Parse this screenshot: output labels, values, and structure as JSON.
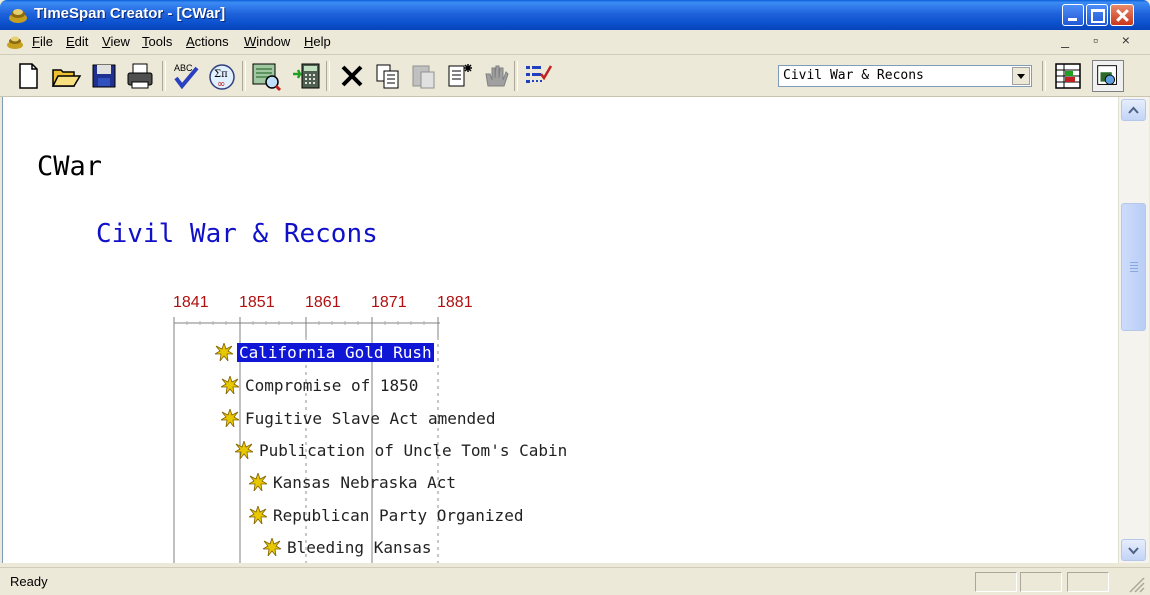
{
  "window": {
    "title": "TImeSpan Creator - [CWar]"
  },
  "menu": [
    {
      "label": "File"
    },
    {
      "label": "Edit"
    },
    {
      "label": "View"
    },
    {
      "label": "Tools"
    },
    {
      "label": "Actions"
    },
    {
      "label": "Window"
    },
    {
      "label": "Help"
    }
  ],
  "toolbar": {
    "timeline_select": "Civil War & Recons",
    "buttons": [
      "new-icon",
      "open-icon",
      "save-icon",
      "print-icon",
      "spellcheck-icon",
      "math-symbols-icon",
      "find-timeline-icon",
      "calculator-icon",
      "delete-icon",
      "copy-icon",
      "paste-icon",
      "paste-special-icon",
      "hand-icon",
      "checklist-icon",
      "properties-icon",
      "zoom-view-icon"
    ]
  },
  "content": {
    "doc_title": "CWar",
    "timeline_title": "Civil War & Recons",
    "years": [
      "1841",
      "1851",
      "1861",
      "1871",
      "1881"
    ],
    "events": [
      {
        "label": "California Gold Rush"
      },
      {
        "label": "Compromise of 1850"
      },
      {
        "label": "Fugitive Slave Act amended"
      },
      {
        "label": "Publication of Uncle Tom's Cabin"
      },
      {
        "label": "Kansas Nebraska Act"
      },
      {
        "label": "Republican Party Organized"
      },
      {
        "label": "Bleeding Kansas"
      }
    ]
  },
  "status": {
    "text": "Ready"
  },
  "colors": {
    "title_bar": "#0a4fcc",
    "timeline_title": "#1010c8",
    "year_labels": "#b01010",
    "selection": "#1016d6",
    "event_icon": "#e8c800"
  }
}
